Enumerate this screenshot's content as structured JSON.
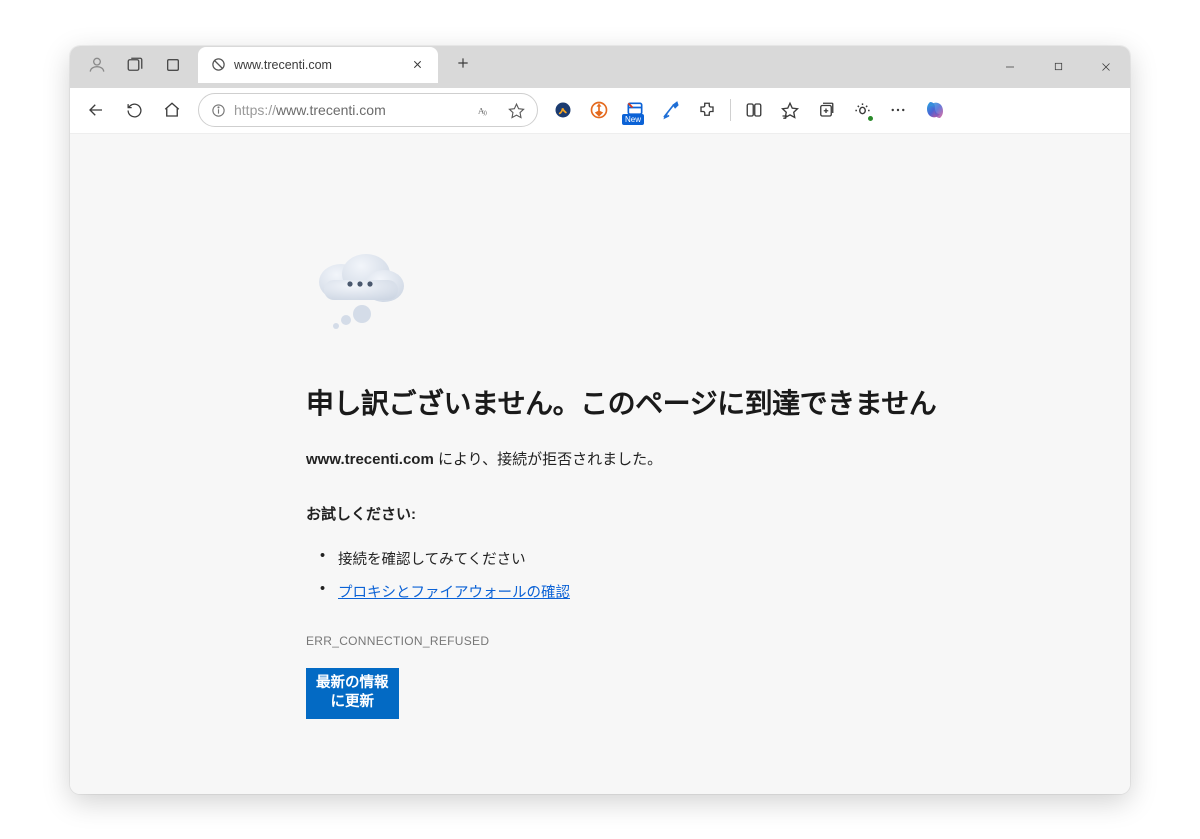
{
  "tab": {
    "title": "www.trecenti.com"
  },
  "address": {
    "protocol": "https://",
    "host": "www.trecenti.com"
  },
  "ext_badge": "New",
  "error": {
    "heading": "申し訳ございません。このページに到達できません",
    "subtitle_host": "www.trecenti.com",
    "subtitle_rest": " により、接続が拒否されました。",
    "try_heading": "お試しください:",
    "try_items": [
      "接続を確認してみてください",
      "プロキシとファイアウォールの確認"
    ],
    "code": "ERR_CONNECTION_REFUSED",
    "refresh_line1": "最新の情報",
    "refresh_line2": "に更新"
  }
}
